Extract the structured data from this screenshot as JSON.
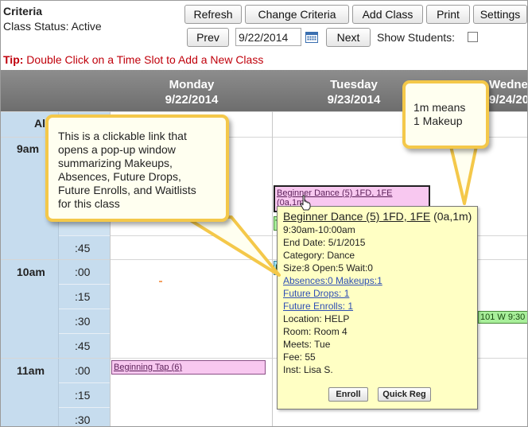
{
  "header": {
    "title": "Criteria",
    "class_status": "Class Status: Active"
  },
  "toolbar": {
    "refresh_label": "Refresh",
    "change_criteria_label": "Change Criteria",
    "add_class_label": "Add Class",
    "print_label": "Print",
    "settings_label": "Settings",
    "prev_label": "Prev",
    "date_value": "9/22/2014",
    "next_label": "Next",
    "show_students_label": "Show Students:",
    "show_students_checked": false
  },
  "tip": {
    "prefix": "Tip:",
    "text": " Double Click on a Time Slot to Add a New Class"
  },
  "calendar": {
    "all_label": "All",
    "days": [
      {
        "name": "Monday",
        "date": "9/22/2014"
      },
      {
        "name": "Tuesday",
        "date": "9/23/2014"
      },
      {
        "name": "Wedne",
        "date": "9/24/20"
      }
    ],
    "hours": [
      "9am",
      "10am",
      "11am"
    ],
    "minute_labels": [
      ":45",
      ":00",
      ":15",
      ":30",
      ":45",
      ":00",
      ":15",
      ":30"
    ],
    "classes": {
      "tuesday_beginner_dance_line1": "Beginner Dance (5) 1FD, 1FE",
      "tuesday_beginner_dance_line2": "(0a,1m)",
      "monday_beginning_tap": "Beginning Tap (6)",
      "wed_class": "101 W 9:30",
      "tuesday_green_1": "Tu",
      "tuesday_green_2": "L"
    }
  },
  "popup": {
    "title_link": "Beginner Dance (5) 1FD, 1FE",
    "title_suffix": " (0a,1m)",
    "time": "9:30am-10:00am",
    "end_date": "End Date: 5/1/2015",
    "category": "Category: Dance",
    "size": "Size:8 Open:5 Wait:0",
    "absences_link": "Absences:0 Makeups:1",
    "future_drops_link": "Future Drops: 1",
    "future_enrolls_link": "Future Enrolls: 1",
    "location": "Location: HELP",
    "room": "Room: Room 4",
    "meets": "Meets: Tue",
    "fee": "Fee: 55",
    "inst": "Inst: Lisa S.",
    "enroll_label": "Enroll",
    "quick_reg_label": "Quick Reg"
  },
  "callouts": {
    "left_text_1": "This is a clickable link that",
    "left_text_2": "opens a pop-up window",
    "left_text_3": "summarizing Makeups,",
    "left_text_4": "Absences, Future Drops,",
    "left_text_5": "Future Enrolls, and Waitlists",
    "left_text_6": "for this class",
    "right_text_1": "1m means",
    "right_text_2": "1 Makeup"
  },
  "colors": {
    "tip_red": "#c0000b",
    "header_gray": "#7a7a7a",
    "time_column_blue": "#c6dcee",
    "class_pink": "#f8c8f0",
    "class_green": "#a8ef9a",
    "popup_yellow": "#ffffc4",
    "callout_border": "#f4c84a",
    "link_blue": "#2f4fb4"
  }
}
